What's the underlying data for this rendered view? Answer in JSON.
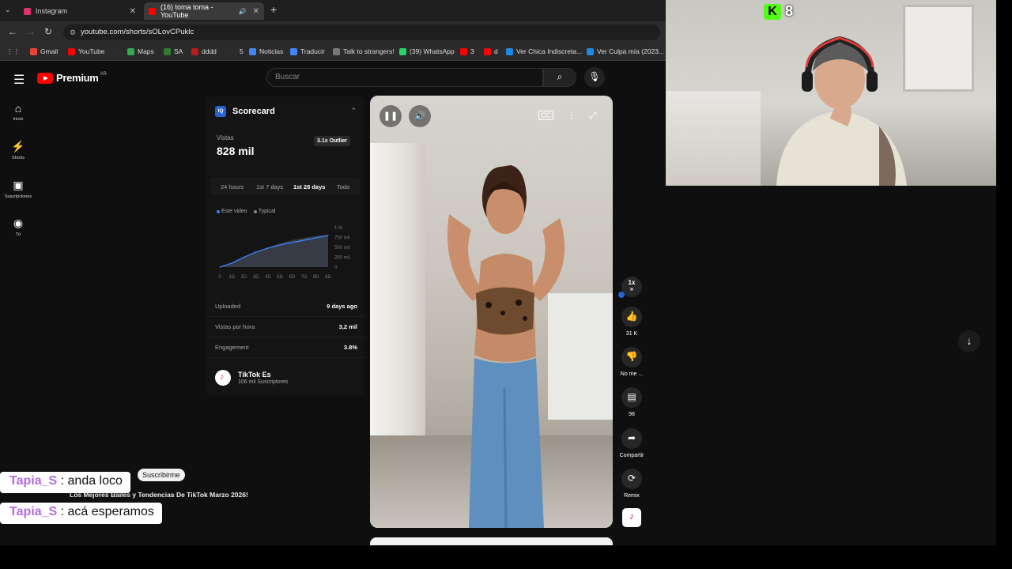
{
  "browser": {
    "tab_menu_glyph": "⌄",
    "tabs": [
      {
        "title": "Instagram",
        "favicon_color": "#e1306c",
        "close": "✕"
      },
      {
        "title": "(16) toma toma - YouTube",
        "favicon_color": "#ff0000",
        "close": "✕",
        "audio_icon": "🔊"
      }
    ],
    "new_tab": "+",
    "address": "youtube.com/shorts/sOLovCPuklc",
    "bookmarks": [
      {
        "label": "Gmail",
        "color": "#ea4335"
      },
      {
        "label": "YouTube",
        "color": "#ff0000"
      },
      {
        "label": "Maps",
        "color": "#34a853"
      },
      {
        "label": "SA",
        "color": "#2e7d32"
      },
      {
        "label": "dddd",
        "color": "#b71c1c"
      },
      {
        "label": "5",
        "color": "#2b2b2b"
      },
      {
        "label": "Noticias",
        "color": "#4285f4"
      },
      {
        "label": "Traducir",
        "color": "#4285f4"
      },
      {
        "label": "Talk to strangers!",
        "color": "#777777"
      },
      {
        "label": "(39) WhatsApp",
        "color": "#25d366"
      },
      {
        "label": "3",
        "color": "#ff0000"
      },
      {
        "label": "d",
        "color": "#ff0000"
      },
      {
        "label": "Ver Chica Indiscreta...",
        "color": "#1e88e5"
      },
      {
        "label": "Ver Culpa mía (2023...",
        "color": "#1e88e5"
      }
    ]
  },
  "youtube": {
    "logo_text": "Premium",
    "country_code": "AR",
    "search_placeholder": "Buscar",
    "sidebar": [
      {
        "icon": "⌂",
        "label": "Inicio",
        "name": "home"
      },
      {
        "icon": "⚡",
        "label": "Shorts",
        "name": "shorts"
      },
      {
        "icon": "▣",
        "label": "Suscripciones",
        "name": "subscriptions"
      },
      {
        "icon": "◉",
        "label": "Tú",
        "name": "you"
      }
    ]
  },
  "scorecard": {
    "badge": "IQ",
    "title": "Scorecard",
    "views_label": "Vistas",
    "views_value": "828 mil",
    "outlier": "3.1x Outlier",
    "time_tabs": [
      "24 hours",
      "1st 7 days",
      "1st 28 days",
      "Todo"
    ],
    "active_tab": 2,
    "legend": [
      {
        "label": "Este video",
        "color": "#3b82f6"
      },
      {
        "label": "Typical",
        "color": "#888888"
      }
    ],
    "stats": [
      {
        "label": "Uploaded",
        "value": "9 days ago"
      },
      {
        "label": "Vistas por hora",
        "value": "3,2 mil"
      },
      {
        "label": "Engagement",
        "value": "3.8%"
      }
    ],
    "channel_name": "TikTok Es",
    "channel_subs": "106 mil Suscriptores"
  },
  "chart_data": {
    "type": "line",
    "x": [
      "0",
      "1D",
      "2D",
      "3D",
      "4D",
      "5D",
      "6D",
      "7D",
      "8D",
      "9D"
    ],
    "yticks": [
      "1 M",
      "750 mil",
      "500 mil",
      "250 mil",
      "0"
    ],
    "ylim": [
      0,
      1000000
    ],
    "series": [
      {
        "name": "Este video",
        "values": [
          0,
          100000,
          250000,
          380000,
          480000,
          560000,
          620000,
          680000,
          740000,
          800000
        ]
      },
      {
        "name": "Typical",
        "values": [
          0,
          120000,
          250000,
          380000,
          500000,
          600000,
          680000,
          740000,
          790000,
          820000
        ]
      }
    ]
  },
  "actions": {
    "speed_label": "1x",
    "likes": "31 K",
    "dislike_label": "No me ...",
    "comments": "98",
    "share_label": "Compartir",
    "remix_label": "Remix"
  },
  "overlay": {
    "chat": [
      {
        "user": "Tapia_S",
        "message": ": anda loco"
      },
      {
        "user": "Tapia_S",
        "message": ": acá esperamos"
      }
    ],
    "subscribe_label": "Suscribirme",
    "playlist_text": "Los Mejores Bailes y Tendencias De TikTok Marzo 2026!"
  },
  "stream": {
    "kick_letter": "K",
    "viewer_count": "8"
  }
}
